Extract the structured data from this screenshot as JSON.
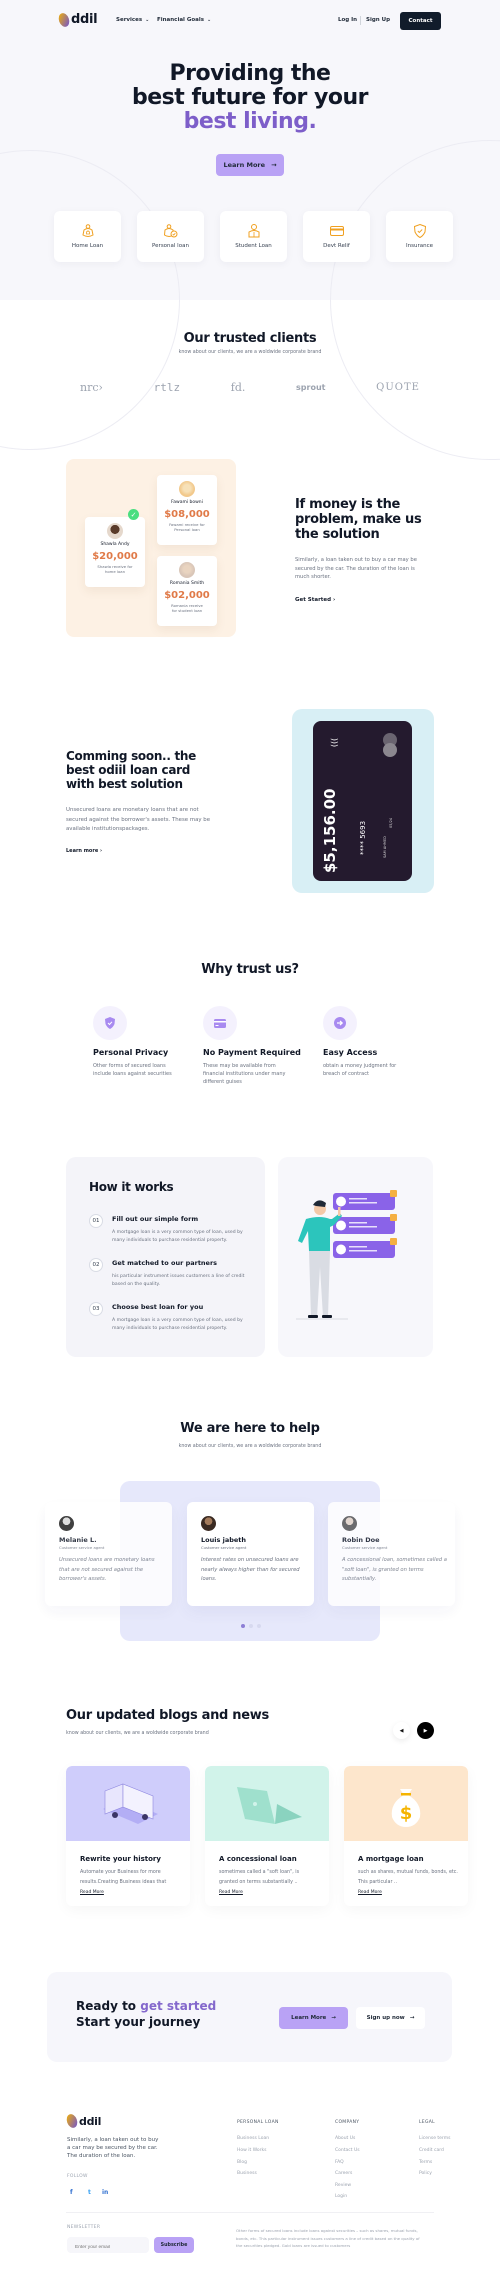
{
  "brand": {
    "name": "ddil",
    "accent": "#7d5ec9",
    "button_bg": "#b9a2f5",
    "dark": "#111c2b"
  },
  "nav": {
    "items": [
      {
        "label": "Services"
      },
      {
        "label": "Financial Goals"
      }
    ],
    "login": "Log In",
    "signup": "Sign Up",
    "contact": "Contact"
  },
  "hero": {
    "title_line1": "Providing the",
    "title_line2": "best future for your",
    "title_accent": "best living.",
    "cta": "Learn More",
    "services": [
      {
        "label": "Home Loan",
        "icon": "money-bag-house-icon"
      },
      {
        "label": "Personal loan",
        "icon": "money-bag-check-icon"
      },
      {
        "label": "Student Loan",
        "icon": "student-reading-icon"
      },
      {
        "label": "Devt Relif",
        "icon": "credit-card-icon"
      },
      {
        "label": "Insurance",
        "icon": "shield-check-icon"
      }
    ]
  },
  "clients": {
    "title": "Our trusted clients",
    "subtitle": "know about our clients, we are a woldwide corporate brand",
    "logos": [
      "nrc›",
      "rtlz",
      "fd.",
      "sprout",
      "QUOTE"
    ]
  },
  "money": {
    "people": [
      {
        "name": "Shawla Andy",
        "amount": "$20,000",
        "desc": "Shawla receive for home loan"
      },
      {
        "name": "Fawami bowni",
        "amount": "$08,000",
        "desc": "Fawami receive for Personal loan"
      },
      {
        "name": "Romania Smith",
        "amount": "$02,000",
        "desc": "Romania receive for student loan"
      }
    ],
    "title_line1": "If money is the",
    "title_line2": "problem, make us",
    "title_line3": "the solution",
    "body": "Similarly, a loan taken out to buy a car may be secured by the car. The duration of the loan is much shorter.",
    "link": "Get Started"
  },
  "card": {
    "title_line1": "Comming soon.. the",
    "title_line2": "best odiil loan card",
    "title_line3": "with best solution",
    "body": "Unsecured loans are monetary loans that are not secured against the borrower's assets. These may be available institutionspackages.",
    "link": "Learn more",
    "balance": "$5,156.00",
    "number": "**** 5693",
    "holder": "SAM AHMED",
    "expiry": "05/24"
  },
  "why": {
    "title": "Why trust us?",
    "items": [
      {
        "title": "Personal Privacy",
        "desc": "Other forms of secured loans include loans against securities",
        "icon": "shield-check-icon"
      },
      {
        "title": "No Payment Required",
        "desc": "These may be available from financial institutions under many different guises",
        "icon": "credit-card-icon"
      },
      {
        "title": "Easy Access",
        "desc": "obtain a money judgment for breach of contract",
        "icon": "arrow-circle-icon"
      }
    ]
  },
  "how": {
    "title": "How it works",
    "steps": [
      {
        "num": "01",
        "title": "Fill out our simple form",
        "desc": "A mortgage loan is a very common type of loan, used by many individuals to purchase residential property."
      },
      {
        "num": "02",
        "title": "Get matched to our partners",
        "desc": "his particular instrument issues customers a line of credit based on the quality."
      },
      {
        "num": "03",
        "title": "Choose best loan for you",
        "desc": "A mortgage loan is a very common type of loan, used by many individuals to purchase residential property."
      }
    ]
  },
  "help": {
    "title": "We are here to help",
    "subtitle": "know about our clients, we are a woldwide corporate brand",
    "agents": [
      {
        "name": "Melanie L.",
        "role": "Customer service agent",
        "quote": "Unsecured loans are monetary loans that are not secured against the borrower's assets."
      },
      {
        "name": "Louis jabeth",
        "role": "Customer service agent",
        "quote": "Interest rates on unsecured loans are nearly always higher than for secured loans."
      },
      {
        "name": "Robin Doe",
        "role": "Customer service agent",
        "quote": "A concessional loan, sometimes called a \"soft loan\", is granted on terms substantially."
      }
    ],
    "active_slide": 1,
    "slide_count": 3
  },
  "blog": {
    "title": "Our updated blogs and news",
    "subtitle": "know about our clients, we are a woldwide corporate brand",
    "posts": [
      {
        "title": "Rewrite your history",
        "desc": "Automate your Business for more results.Creating Business ideas that",
        "link": "Read More",
        "bg": "#cfcdfb"
      },
      {
        "title": "A concessional loan",
        "desc": "sometimes called a \"soft loan\", is granted on terms substantially ..",
        "link": "Read More",
        "bg": "#d1f3ea"
      },
      {
        "title": "A mortgage loan",
        "desc": "such as shares, mutual funds, bonds, etc. This particular ..",
        "link": "Read More",
        "bg": "#fde6cc"
      }
    ]
  },
  "cta": {
    "line1": "Ready to",
    "accent": "get started",
    "line2": "Start your journey",
    "primary": "Learn More",
    "secondary": "Sign up now"
  },
  "footer": {
    "about": "Similarly, a loan taken out to buy a car may be secured by the car. The duration of the loan.",
    "follow": "FOLLOW",
    "social": [
      "f",
      "t",
      "in"
    ],
    "columns": [
      {
        "title": "PERSONAL LOAN",
        "links": [
          "Business Loan",
          "How it Works",
          "Blog",
          "Business"
        ]
      },
      {
        "title": "COMPANY",
        "links": [
          "About Us",
          "Contact Us",
          "FAQ",
          "Careers",
          "Review",
          "Login"
        ]
      },
      {
        "title": "LEGAL",
        "links": [
          "License terms",
          "Credit card",
          "Terms",
          "Policy"
        ]
      }
    ],
    "newsletter": "NEWSLETTER",
    "email_placeholder": "Enter your email",
    "subscribe": "Subscribe",
    "disclaimer": "Other forms of secured loans include loans against securities – such as shares, mutual funds, bonds, etc. This particular instrument issues customers a line of credit based on the quality of the securities pledged. Gold loans are issued to customers"
  }
}
